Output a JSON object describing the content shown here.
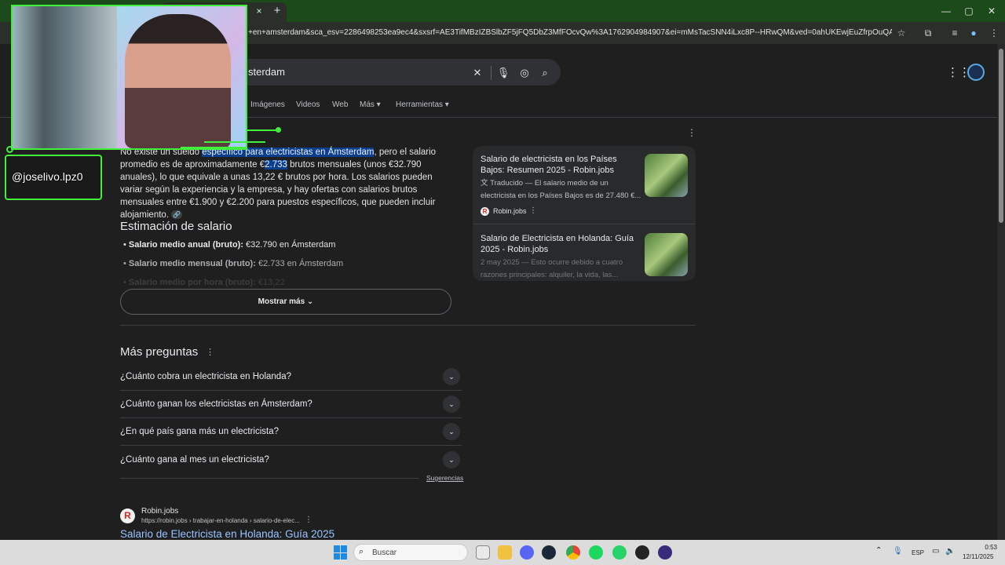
{
  "browser": {
    "tab_close": "×",
    "new_tab": "+",
    "url": "+en+amsterdam&sca_esv=2286498253ea9ec4&sxsrf=AE3TifMBzIZBSlbZF5jFQ5DbZ3MfFOcvQw%3A1762904984907&ei=mMsTacSNN4iLxc8P--HRwQM&ved=0ahUKEwjEuZfrpOuQAxWlRfEDHftwN...",
    "window_controls": {
      "minimize": "—",
      "maximize": "▢",
      "close": "✕"
    }
  },
  "search": {
    "query": "sterdam",
    "tabs": [
      "Imágenes",
      "Videos",
      "Web",
      "Más ▾",
      "Herramientas ▾"
    ]
  },
  "ai_overview": {
    "intro_prefix": "No existe un sueldo",
    "intro_highlight": "específico para electricistas en Ámsterdam",
    "intro_mid": ", pero el salario promedio es de aproximadamente €",
    "intro_highlight2": "2.733",
    "intro_suffix": " brutos mensuales (unos €32.790 anuales), lo que equivale a unas 13,22 € brutos por hora. Los salarios pueden variar según la experiencia y la empresa, y hay ofertas con salarios brutos mensuales entre €1.900 y €2.200 para puestos específicos, que pueden incluir alojamiento.",
    "estimate_title": "Estimación de salario",
    "bullets": [
      {
        "label": "Salario medio anual (bruto):",
        "value": " €32.790 en Ámsterdam"
      },
      {
        "label": "Salario medio mensual (bruto):",
        "value": " €2.733 en Ámsterdam"
      },
      {
        "label": "Salario medio por hora (bruto):",
        "value": " €13,22"
      }
    ],
    "show_more": "Mostrar más"
  },
  "side_cards": [
    {
      "title": "Salario de electricista en los Países Bajos: Resumen 2025 - Robin.jobs",
      "snippet": "Traducido — El salario medio de un electricista en los Países Bajos es de 27.480 €...",
      "source": "Robin.jobs"
    },
    {
      "title": "Salario de Electricista en Holanda: Guía 2025 - Robin.jobs",
      "snippet": "2 may 2025 — Esto ocurre debido a cuatro razones principales: alquiler, la vida, las..."
    }
  ],
  "paa": {
    "title": "Más preguntas",
    "questions": [
      "¿Cuánto cobra un electricista en Holanda?",
      "¿Cuánto ganan los electricistas en Ámsterdam?",
      "¿En qué país gana más un electricista?",
      "¿Cuánto gana al mes un electricista?"
    ],
    "suggestions": "Sugerencias"
  },
  "result": {
    "site": "Robin.jobs",
    "url": "https://robin.jobs › trabajar-en-holanda › salario-de-elec...",
    "title": "Salario de Electricista en Holanda: Guía 2025"
  },
  "overlay": {
    "handle": "@joselivo.lpz0"
  },
  "taskbar": {
    "search_label": "Buscar",
    "language": "ESP",
    "time": "0:53",
    "date": "12/11/2025"
  }
}
